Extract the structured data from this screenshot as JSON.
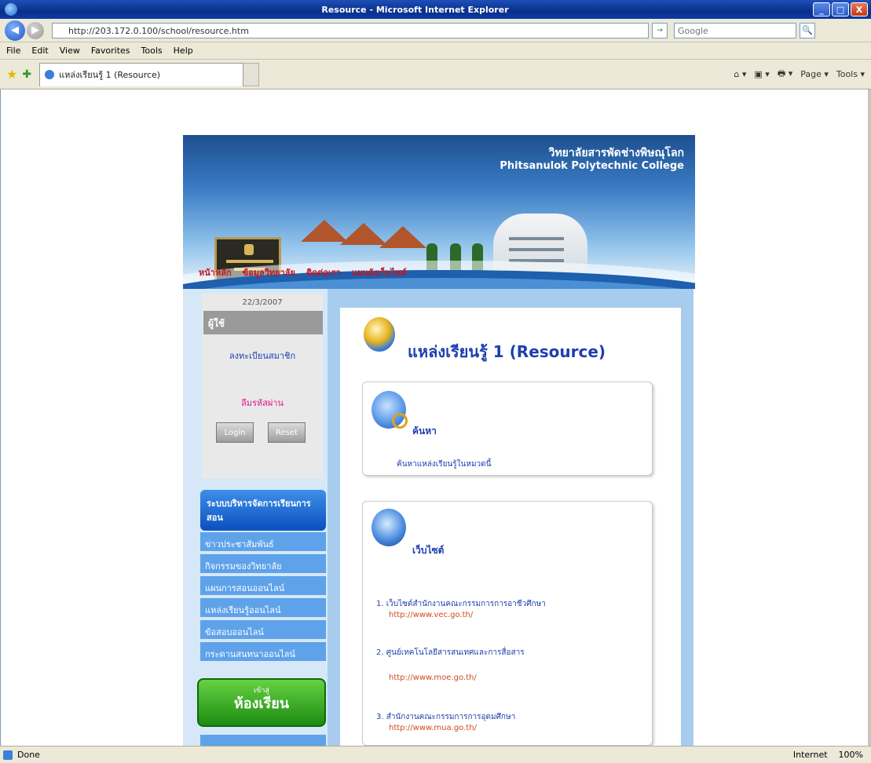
{
  "window": {
    "title": "Resource - Microsoft Internet Explorer",
    "controls": [
      "_",
      "□",
      "X"
    ]
  },
  "addressbar": {
    "url": "http://203.172.0.100/school/resource.htm",
    "search_placeholder": "Google",
    "go_label": "→",
    "search_label": "🔍"
  },
  "menubar": {
    "items": [
      "File",
      "Edit",
      "View",
      "Favorites",
      "Tools",
      "Help"
    ]
  },
  "tab": {
    "title": "แหล่งเรียนรู้ 1 (Resource)",
    "toolbar_right": [
      "⌂ ▾",
      "▣ ▾",
      "🖶 ▾",
      "Page ▾",
      "Tools ▾"
    ]
  },
  "banner": {
    "title_th": "วิทยาลัยสารพัดช่างพิษณุโลก",
    "title_en": "Phitsanulok Polytechnic College"
  },
  "topnav": [
    "หน้าหลัก",
    "ข้อมูลวิทยาลัย",
    "ติดต่อเรา",
    "แผนผังเว็บไซต์"
  ],
  "login": {
    "date": "22/3/2007",
    "heading": "ผู้ใช้",
    "register": "ลงทะเบียนสมาชิก",
    "forgot": "ลืมรหัสผ่าน",
    "btn_login": "Login",
    "btn_reset": "Reset"
  },
  "sidebar": {
    "heading": "ระบบบริหารจัดการเรียนการสอน",
    "items": [
      "ข่าวประชาสัมพันธ์",
      "กิจกรรมของวิทยาลัย",
      "แผนการสอนออนไลน์",
      "แหล่งเรียนรู้ออนไลน์",
      "ข้อสอบออนไลน์",
      "กระดานสนทนาออนไลน์"
    ],
    "green_button_small": "เข้าสู่",
    "green_button": "ห้องเรียน"
  },
  "main": {
    "title": "แหล่งเรียนรู้ 1 (Resource)",
    "card1": {
      "title": "ค้นหา",
      "text": "ค้นหาแหล่งเรียนรู้ในหมวดนี้"
    },
    "card2": {
      "title": "เว็บไซต์",
      "links": [
        {
          "num": "1.",
          "label": "เว็บไซต์สำนักงานคณะกรรมการการอาชีวศึกษา",
          "url": "http://www.vec.go.th/"
        },
        {
          "num": "2.",
          "label": "ศูนย์เทคโนโลยีสารสนเทศและการสื่อสาร",
          "url": "http://www.moe.go.th/"
        },
        {
          "num": "3.",
          "label": "สำนักงานคณะกรรมการการอุดมศึกษา",
          "url": "http://www.mua.go.th/"
        }
      ]
    }
  },
  "statusbar": {
    "text": "Done",
    "zone": "Internet",
    "zoom": "100%"
  }
}
